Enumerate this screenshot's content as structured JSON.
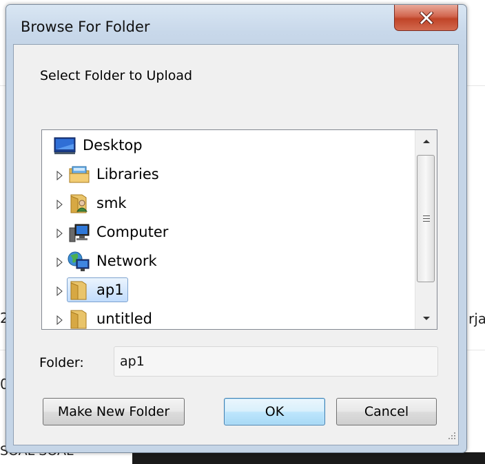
{
  "background": {
    "fragment_left_1": "2",
    "fragment_left_2": "0",
    "fragment_right": "rja",
    "fragment_bottom": "SOAL SOAL"
  },
  "dialog": {
    "title": "Browse For Folder",
    "prompt": "Select Folder to Upload",
    "tree": [
      {
        "label": "Desktop",
        "icon": "desktop-icon",
        "expandable": false,
        "selected": false
      },
      {
        "label": "Libraries",
        "icon": "libraries-icon",
        "expandable": true,
        "selected": false
      },
      {
        "label": "smk",
        "icon": "user-folder-icon",
        "expandable": true,
        "selected": false
      },
      {
        "label": "Computer",
        "icon": "computer-icon",
        "expandable": true,
        "selected": false
      },
      {
        "label": "Network",
        "icon": "network-icon",
        "expandable": true,
        "selected": false
      },
      {
        "label": "ap1",
        "icon": "folder-icon",
        "expandable": true,
        "selected": true
      },
      {
        "label": "untitled",
        "icon": "folder-icon",
        "expandable": true,
        "selected": false
      }
    ],
    "folder_label": "Folder:",
    "folder_value": "ap1",
    "make_new_folder_label": "Make New Folder",
    "ok_label": "OK",
    "cancel_label": "Cancel"
  },
  "colors": {
    "window_frame": "#c5d5e7",
    "close_button": "#c04428",
    "selection": "#c1dcfc",
    "default_button_border": "#3c7fb1"
  }
}
